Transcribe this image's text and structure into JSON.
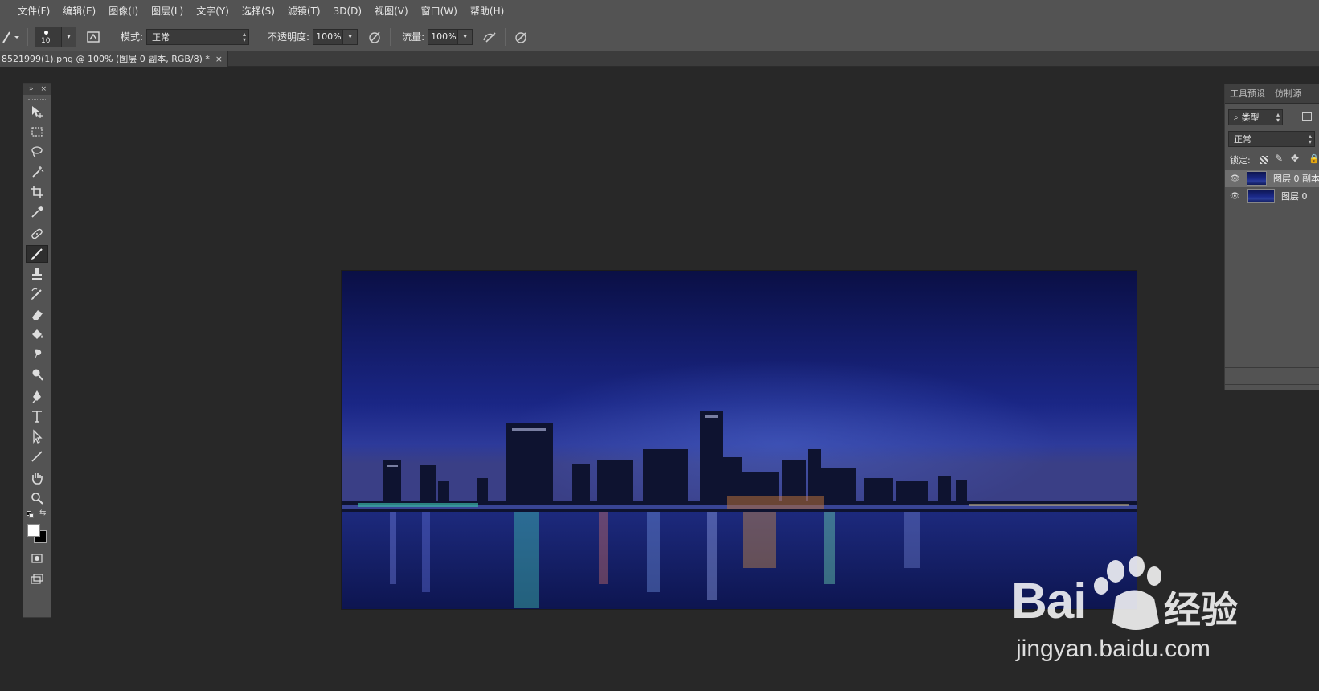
{
  "menu": [
    "文件(F)",
    "编辑(E)",
    "图像(I)",
    "图层(L)",
    "文字(Y)",
    "选择(S)",
    "滤镜(T)",
    "3D(D)",
    "视图(V)",
    "窗口(W)",
    "帮助(H)"
  ],
  "options": {
    "brush_size": "10",
    "mode_label": "模式:",
    "mode_value": "正常",
    "opacity_label": "不透明度:",
    "opacity_value": "100%",
    "flow_label": "流量:",
    "flow_value": "100%"
  },
  "document_tab": {
    "title": "8521999(1).png @ 100% (图层 0 副本, RGB/8) *",
    "close": "×"
  },
  "toolbox": {
    "tools": [
      "move-tool",
      "marquee-tool",
      "lasso-tool",
      "magic-wand-tool",
      "crop-tool",
      "eyedropper-tool",
      "healing-brush-tool",
      "brush-tool",
      "clone-stamp-tool",
      "history-brush-tool",
      "eraser-tool",
      "paint-bucket-tool",
      "smudge-tool",
      "dodge-tool",
      "pen-tool",
      "type-tool",
      "path-selection-tool",
      "line-tool",
      "hand-tool",
      "zoom-tool"
    ],
    "active_tool": "brush-tool",
    "foreground_color": "#ffffff",
    "background_color": "#000000"
  },
  "panel": {
    "tab1": "工具预设",
    "tab2": "仿制源",
    "filter_label": "类型",
    "blend_mode": "正常",
    "lock_label": "锁定:",
    "layers": [
      {
        "name": "图层 0 副本",
        "selected": true
      },
      {
        "name": "图层 0",
        "selected": false
      }
    ]
  },
  "watermark": {
    "brand": "Bai",
    "brand_suffix": "经验",
    "url": "jingyan.baidu.com"
  }
}
